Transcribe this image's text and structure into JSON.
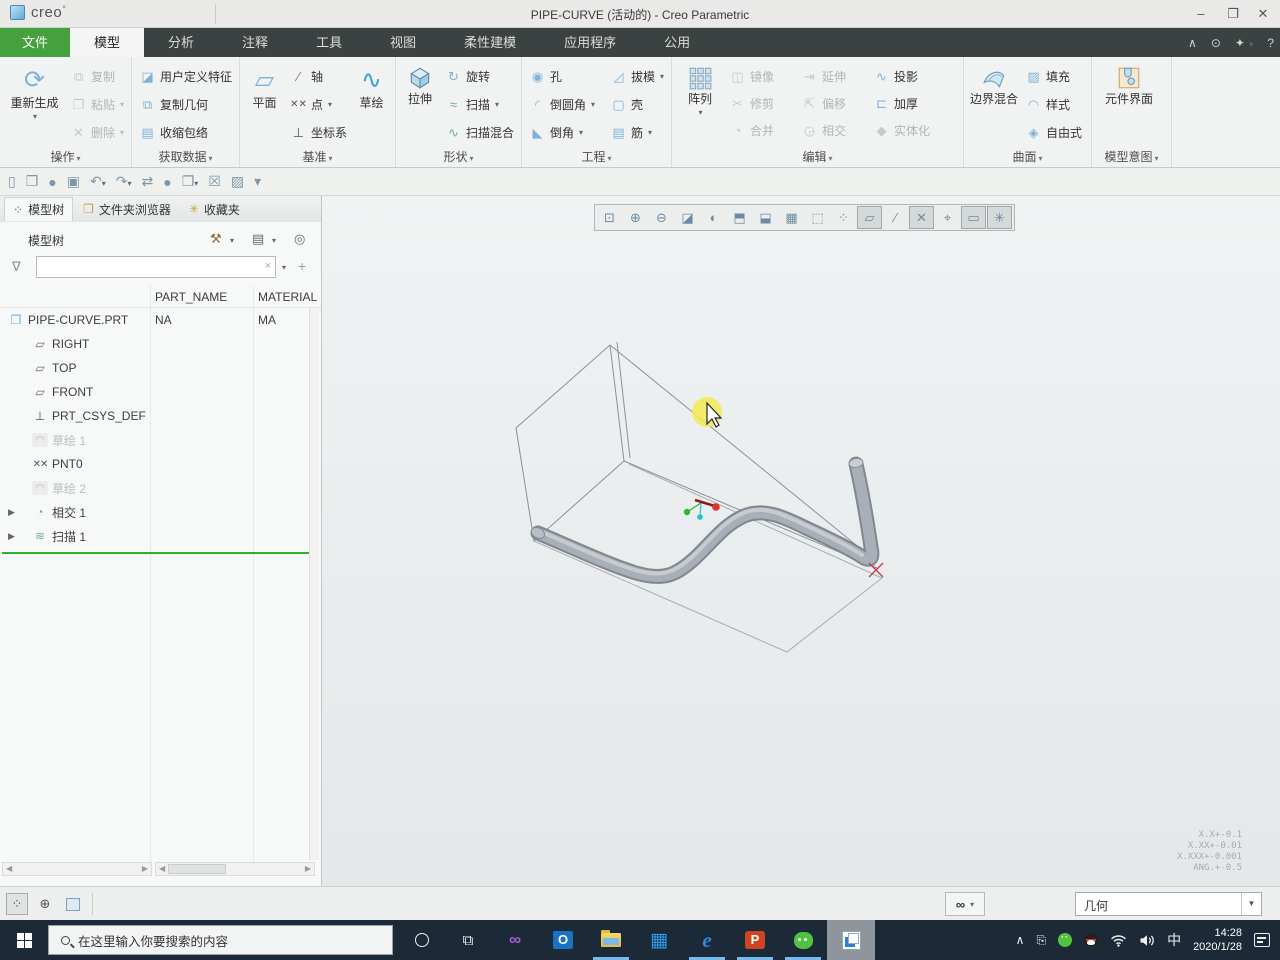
{
  "window": {
    "logo_text": "creo",
    "title": "PIPE-CURVE (活动的) - Creo Parametric",
    "controls": {
      "minimize": "–",
      "restore": "❐",
      "close": "✕"
    }
  },
  "tabstrip": {
    "file_tab": "文件",
    "tabs": [
      "模型",
      "分析",
      "注释",
      "工具",
      "视图",
      "柔性建模",
      "应用程序",
      "公用"
    ],
    "active_tab": "模型",
    "right_icons": [
      "collapse-ribbon",
      "command-search",
      "learning-connector",
      "help"
    ]
  },
  "ribbon": {
    "g0": {
      "label": "操作",
      "regen": "重新生成",
      "copy": "复制",
      "paste": "粘贴",
      "del": "删除"
    },
    "g1": {
      "label": "获取数据",
      "udf": "用户定义特征",
      "copygeom": "复制几何",
      "shrinkwrap": "收缩包络"
    },
    "g2": {
      "label": "基准",
      "plane": "平面",
      "axis": "轴",
      "point": "点",
      "csys": "坐标系",
      "sketch": "草绘"
    },
    "g3": {
      "label": "形状",
      "extrude": "拉伸",
      "revolve": "旋转",
      "sweep": "扫描",
      "sweptblend": "扫描混合"
    },
    "g4": {
      "label": "工程",
      "hole": "孔",
      "round": "倒圆角",
      "chamfer": "倒角",
      "draft": "拔模",
      "shell": "壳",
      "rib": "筋"
    },
    "g5": {
      "label": "编辑",
      "pattern": "阵列",
      "mirror": "镜像",
      "extend": "延伸",
      "project": "投影",
      "trim": "修剪",
      "offset": "偏移",
      "thicken": "加厚",
      "merge": "合并",
      "intersect": "相交",
      "solidify": "实体化"
    },
    "g6": {
      "label": "曲面",
      "boundary": "边界混合",
      "fill": "填充",
      "style": "样式",
      "freestyle": "自由式"
    },
    "g7": {
      "label": "模型意图",
      "compintf": "元件界面"
    }
  },
  "qat": {
    "buttons": [
      {
        "name": "new-file-button",
        "glyph": "▯",
        "arrow": ""
      },
      {
        "name": "open-file-button",
        "glyph": "❒",
        "arrow": ""
      },
      {
        "name": "erase-button",
        "glyph": "●",
        "arrow": ""
      },
      {
        "name": "save-button",
        "glyph": "▣",
        "arrow": ""
      },
      {
        "name": "undo-button",
        "glyph": "↶",
        "arrow": "▾"
      },
      {
        "name": "redo-button",
        "glyph": "↷",
        "arrow": "▾"
      },
      {
        "name": "regenerate-button",
        "glyph": "⇄",
        "arrow": ""
      },
      {
        "name": "model-events-button",
        "glyph": "●",
        "arrow": ""
      },
      {
        "name": "windows-button",
        "glyph": "❐",
        "arrow": "▾"
      },
      {
        "name": "close-window-button",
        "glyph": "☒",
        "arrow": ""
      },
      {
        "name": "object-button",
        "glyph": "▨",
        "arrow": ""
      },
      {
        "name": "customize-qat-button",
        "glyph": "▾",
        "arrow": ""
      }
    ]
  },
  "navigator": {
    "tabs": [
      {
        "label": "模型树",
        "icon": "tree",
        "state": "active"
      },
      {
        "label": "文件夹浏览器",
        "icon": "folder",
        "state": ""
      },
      {
        "label": "收藏夹",
        "icon": "favorites",
        "state": ""
      }
    ]
  },
  "model_tree": {
    "title": "模型树",
    "columns": [
      "PART_NAME",
      "MATERIAL"
    ],
    "root": {
      "label": "PIPE-CURVE.PRT",
      "part_name": "NA",
      "material": "MA"
    },
    "items": [
      {
        "icon": "plane",
        "glyph": "▱",
        "label": "RIGHT",
        "state": "",
        "exp": ""
      },
      {
        "icon": "plane",
        "glyph": "▱",
        "label": "TOP",
        "state": "",
        "exp": ""
      },
      {
        "icon": "plane",
        "glyph": "▱",
        "label": "FRONT",
        "state": "",
        "exp": ""
      },
      {
        "icon": "csys",
        "glyph": "⊥",
        "label": "PRT_CSYS_DEF",
        "state": "",
        "exp": ""
      },
      {
        "icon": "sketch",
        "glyph": "◠",
        "label": "草绘 1",
        "state": "hidden",
        "exp": ""
      },
      {
        "icon": "point",
        "glyph": "✕✕",
        "label": "PNT0",
        "state": "",
        "exp": ""
      },
      {
        "icon": "sketch",
        "glyph": "◠",
        "label": "草绘 2",
        "state": "hidden",
        "exp": ""
      },
      {
        "icon": "intersect",
        "glyph": "◔",
        "label": "相交 1",
        "state": "",
        "exp": "▶"
      },
      {
        "icon": "sweep",
        "glyph": "≋",
        "label": "扫描 1",
        "state": "",
        "exp": "▶"
      }
    ]
  },
  "graphics_toolbar": {
    "buttons": [
      {
        "name": "zoom-fit-button",
        "glyph": "⊡",
        "state": ""
      },
      {
        "name": "zoom-in-button",
        "glyph": "⊕",
        "state": ""
      },
      {
        "name": "zoom-out-button",
        "glyph": "⊖",
        "state": ""
      },
      {
        "name": "repaint-button",
        "glyph": "◪",
        "state": ""
      },
      {
        "name": "shading-button",
        "glyph": "◐",
        "state": ""
      },
      {
        "name": "display-style-button",
        "glyph": "⬒",
        "state": ""
      },
      {
        "name": "saved-orientations-button",
        "glyph": "⬓",
        "state": ""
      },
      {
        "name": "view-manager-button",
        "glyph": "▦",
        "state": ""
      },
      {
        "name": "perspective-button",
        "glyph": "⬚",
        "state": ""
      },
      {
        "name": "datum-display-filters-button",
        "glyph": "⁘",
        "state": ""
      },
      {
        "name": "plane-display-button",
        "glyph": "▱",
        "state": "on"
      },
      {
        "name": "axis-display-button",
        "glyph": "∕",
        "state": ""
      },
      {
        "name": "point-display-button",
        "glyph": "✕",
        "state": "on"
      },
      {
        "name": "csys-display-button",
        "glyph": "⌖",
        "state": ""
      },
      {
        "name": "annotation-display-button",
        "glyph": "▭",
        "state": "on"
      },
      {
        "name": "spin-center-button",
        "glyph": "✳",
        "state": "on"
      }
    ]
  },
  "canvas": {
    "model_name": "PIPE-CURVE",
    "accuracy_overlay": [
      "X.X+-0.1",
      "X.XX+-0.01",
      "X.XXX+-0.001",
      "ANG.+-0.5"
    ]
  },
  "status_bar": {
    "selection_filter": "几何"
  },
  "taskbar": {
    "search_placeholder": "在这里输入你要搜索的内容",
    "apps": [
      {
        "name": "visual-studio-app",
        "cls": "vs",
        "glyph": "∞",
        "state": ""
      },
      {
        "name": "outlook-app",
        "cls": "outlook",
        "glyph": "O",
        "state": ""
      },
      {
        "name": "file-explorer-app",
        "cls": "explorer",
        "glyph": "",
        "state": "running"
      },
      {
        "name": "grid-launcher-app",
        "cls": "grid",
        "glyph": "▦",
        "state": ""
      },
      {
        "name": "edge-app",
        "cls": "edge",
        "glyph": "e",
        "state": "running"
      },
      {
        "name": "powerpoint-app",
        "cls": "ppt",
        "glyph": "P",
        "state": "running"
      },
      {
        "name": "wechat-app",
        "cls": "wechat",
        "glyph": "",
        "state": "running"
      },
      {
        "name": "creo-app",
        "cls": "creo",
        "glyph": "",
        "state": "active"
      }
    ],
    "tray": {
      "ime": "中",
      "time": "14:28",
      "date": "2020/1/28"
    }
  },
  "colors": {
    "creo_green": "#44a13d",
    "taskbar_bg": "#1c2a38",
    "highlight_yellow": "#f1e956",
    "insert_line_green": "#2fae2f",
    "pipe_gray": "#a9afb7"
  }
}
